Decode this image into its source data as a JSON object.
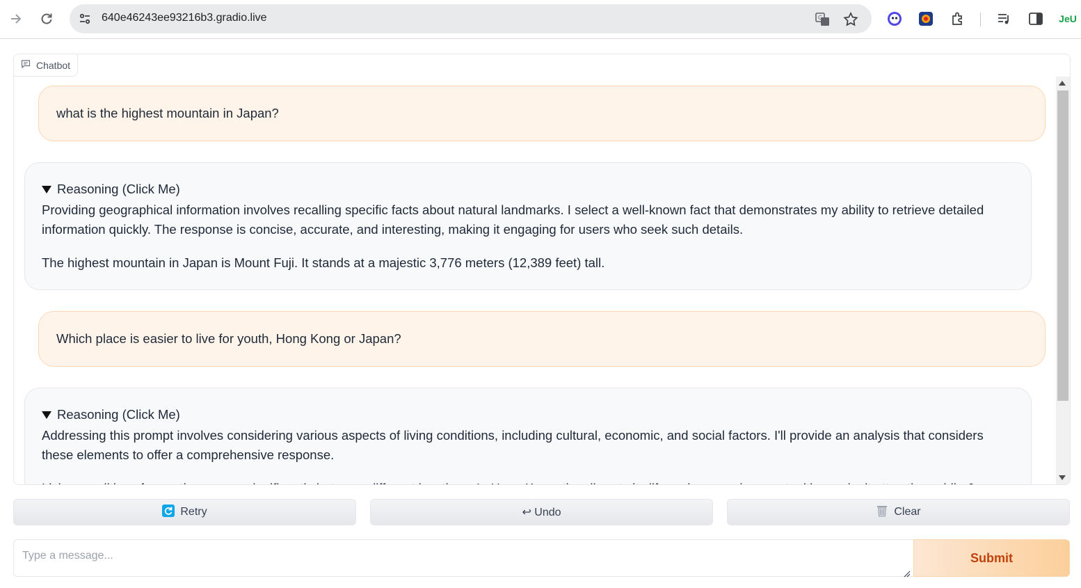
{
  "browser": {
    "url": "640e46243ee93216b3.gradio.live",
    "ext_label": "JeU"
  },
  "chatbot": {
    "label": "Chatbot",
    "messages": [
      {
        "role": "user",
        "text": "what is the highest mountain in Japan?"
      },
      {
        "role": "bot",
        "reasoning_label": "Reasoning (Click Me)",
        "reasoning_text": "Providing geographical information involves recalling specific facts about natural landmarks. I select a well-known fact that demonstrates my ability to retrieve detailed information quickly. The response is concise, accurate, and interesting, making it engaging for users who seek such details.",
        "answer": "The highest mountain in Japan is Mount Fuji. It stands at a majestic 3,776 meters (12,389 feet) tall."
      },
      {
        "role": "user",
        "text": "Which place is easier to live for youth, Hong Kong or Japan?"
      },
      {
        "role": "bot",
        "reasoning_label": "Reasoning (Click Me)",
        "reasoning_text": "Addressing this prompt involves considering various aspects of living conditions, including cultural, economic, and social factors. I'll provide an analysis that considers these elements to offer a comprehensive response.",
        "answer": "Living conditions for youth can vary significantly between different locations. In Hong Kong, the vibrant city life and economic opportunities make it attractive, while Japan offers a high quality of life and safety."
      }
    ]
  },
  "actions": {
    "retry": "Retry",
    "undo": "↩ Undo",
    "clear": "Clear"
  },
  "input": {
    "placeholder": "Type a message...",
    "submit": "Submit"
  }
}
